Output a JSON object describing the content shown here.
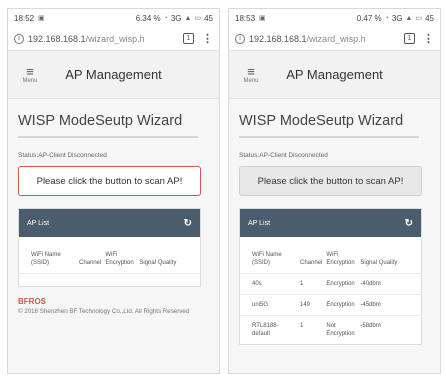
{
  "screens": [
    {
      "status": {
        "time": "18:52",
        "battery_pct": "6.34 %",
        "signal": "3G",
        "battery": "45"
      },
      "url": {
        "host": "192.168.168.1",
        "path": "/wizard_wisp.h",
        "tabs": "1"
      },
      "header": {
        "menu_label": "Menu",
        "title": "AP Management"
      },
      "wizard_title": "WISP ModeSeutp Wizard",
      "status_line": "Status:AP-Client Disconnected",
      "scan_button": "Please click the button to scan AP!",
      "ap_list": {
        "title": "AP List",
        "columns": [
          "WiFi Name (SSID)",
          "Channel",
          "WiFi Encryption",
          "Signal Quality"
        ],
        "rows": []
      },
      "footer": {
        "brand": "BFROS",
        "copyright": "© 2016 Shenzhen BF Technology Co.,Ltd. All Rights Reserved"
      }
    },
    {
      "status": {
        "time": "18:53",
        "battery_pct": "0.47 %",
        "signal": "3G",
        "battery": "45"
      },
      "url": {
        "host": "192.168.168.1",
        "path": "/wizard_wisp.h",
        "tabs": "1"
      },
      "header": {
        "menu_label": "Menu",
        "title": "AP Management"
      },
      "wizard_title": "WISP ModeSeutp Wizard",
      "status_line": "Status:AP-Client Disconnected",
      "scan_button": "Please click the button to scan AP!",
      "ap_list": {
        "title": "AP List",
        "columns": [
          "WiFi Name (SSID)",
          "Channel",
          "WiFi Encryption",
          "Signal Quality"
        ],
        "rows": [
          [
            "40s",
            "1",
            "Encryption",
            "-40dbm"
          ],
          [
            "uni5G",
            "149",
            "Encryption",
            "-45dbm"
          ],
          [
            "RTL8188-default",
            "1",
            "Not Encryption",
            "-58dbm"
          ]
        ]
      }
    }
  ]
}
